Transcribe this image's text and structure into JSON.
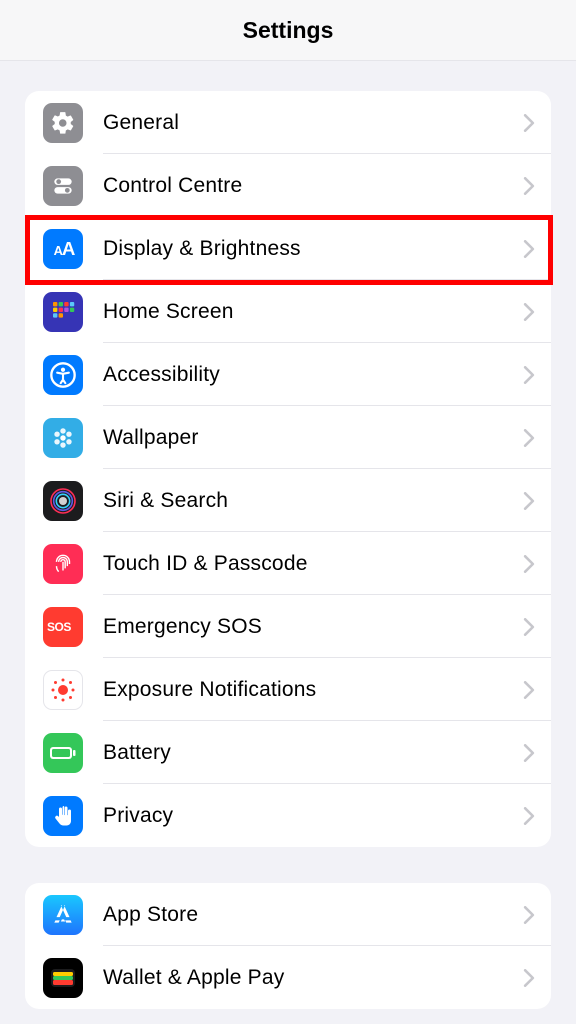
{
  "header": {
    "title": "Settings"
  },
  "groups": [
    {
      "rows": [
        {
          "id": "general",
          "label": "General"
        },
        {
          "id": "control-centre",
          "label": "Control Centre"
        },
        {
          "id": "display-brightness",
          "label": "Display & Brightness",
          "highlighted": true
        },
        {
          "id": "home-screen",
          "label": "Home Screen"
        },
        {
          "id": "accessibility",
          "label": "Accessibility"
        },
        {
          "id": "wallpaper",
          "label": "Wallpaper"
        },
        {
          "id": "siri-search",
          "label": "Siri & Search"
        },
        {
          "id": "touch-id-passcode",
          "label": "Touch ID & Passcode"
        },
        {
          "id": "emergency-sos",
          "label": "Emergency SOS"
        },
        {
          "id": "exposure-notifications",
          "label": "Exposure Notifications"
        },
        {
          "id": "battery",
          "label": "Battery"
        },
        {
          "id": "privacy",
          "label": "Privacy"
        }
      ]
    },
    {
      "rows": [
        {
          "id": "app-store",
          "label": "App Store"
        },
        {
          "id": "wallet-apple-pay",
          "label": "Wallet & Apple Pay"
        }
      ]
    }
  ]
}
